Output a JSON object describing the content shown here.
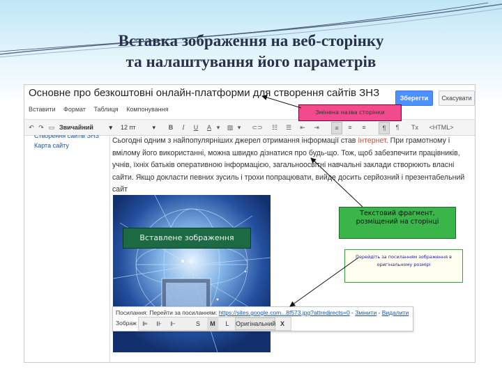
{
  "slide": {
    "title_line1": "Вставка зображення на веб-сторінку",
    "title_line2": "та налаштування його параметрів"
  },
  "editor": {
    "page_title": "Основне про безкоштовні онлайн-платформи для створення сайтів ЗНЗ",
    "save_label": "Зберегти",
    "cancel_label": "Скасувати",
    "menu": [
      "Вставити",
      "Формат",
      "Таблиця",
      "Компонування"
    ],
    "toolbar": {
      "style_value": "Звичайний",
      "size_value": "12 пт",
      "bold": "B",
      "italic": "I",
      "underline": "U",
      "font_color": "A",
      "html": "<HTML>",
      "clear": "Tx"
    },
    "sidebar": {
      "cut_item": "Створення сайтів ЗНЗ",
      "link": "Карта сайту"
    },
    "paragraph": {
      "part1": "Сьогодні одним з найпопулярніших джерел отримання інформації став ",
      "highlight": "Інтернет",
      "part2": ". При грамотному і вмілому його використанні, можна швидко дізнатися про будь-що. Тож, щоб забезпечити працівників, учнів, їхніх батьків оперативною інформацією, загальноосвітні навчальні заклади створюють власні сайти. Якщо докласти певних зусиль і трохи попрацювати, вийде досить серйозний і презентабельний сайт"
    },
    "link_bar": {
      "label": "Посилання: ",
      "goto": "Перейти за посиланням: ",
      "url": "https://sites.google.com...8f573.jpg?attredirects=0",
      "separator": " - ",
      "change": "Змінити",
      "remove": "Видалити",
      "image_label": "Зображ",
      "sizes": [
        "S",
        "M",
        "L"
      ],
      "original": "Оригінальний",
      "close": "X"
    }
  },
  "callouts": {
    "renamed_title": "Змінена назва сторінки",
    "inserted_image": "Вставлене зображення",
    "text_fragment": "Текстовий фрагмент, розміщений на сторінці",
    "goto_tip": "Перейдіть за посиланням зображення в оригінальному розмірі"
  },
  "colors": {
    "save_button": "#4d90fe",
    "highlight_text": "#dd4b39",
    "callout_pink": "#f24a8d",
    "callout_dark_green": "#1c6a43",
    "callout_green": "#39b54a"
  }
}
